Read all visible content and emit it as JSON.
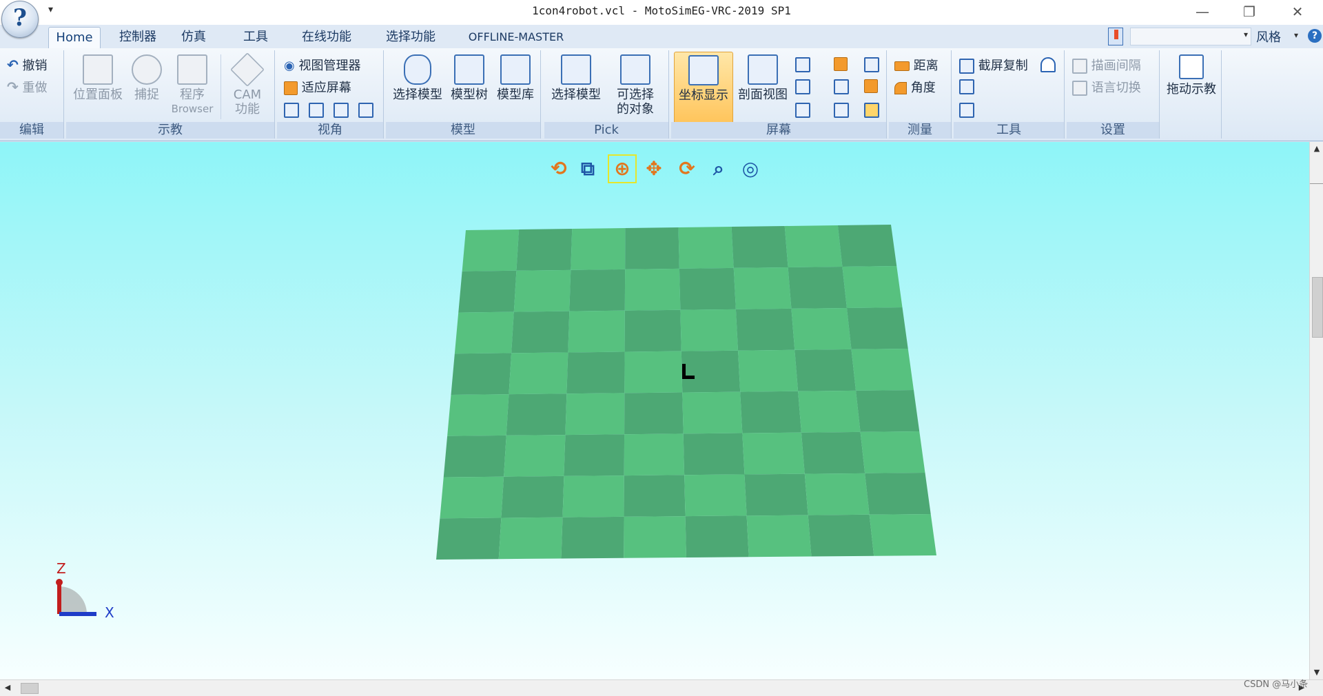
{
  "window": {
    "title": "1con4robot.vcl - MotoSimEG-VRC-2019 SP1",
    "app_logo": "?",
    "quick_access": "▾",
    "minimize": "—",
    "restore": "❐",
    "close": "✕"
  },
  "tabs": [
    {
      "label": "Home",
      "active": true
    },
    {
      "label": "控制器"
    },
    {
      "label": "仿真"
    },
    {
      "label": "工具"
    },
    {
      "label": "在线功能"
    },
    {
      "label": "选择功能"
    },
    {
      "label": "OFFLINE-MASTER"
    }
  ],
  "topright": {
    "style_label": "风格",
    "dropdown_arrow": "▾",
    "help": "?"
  },
  "ribbon": {
    "edit": {
      "label": "编辑",
      "undo": "撤销",
      "redo": "重做"
    },
    "teach": {
      "label": "示教",
      "position_panel": "位置面板",
      "capture": "捕捉",
      "program_line1": "程序",
      "program_line2": "Browser",
      "cam_line1": "CAM",
      "cam_line2": "功能"
    },
    "view": {
      "label": "视角",
      "view_manager": "视图管理器",
      "fit_screen": "适应屏幕"
    },
    "model": {
      "label": "模型",
      "select_model": "选择模型",
      "model_tree": "模型树",
      "model_library": "模型库"
    },
    "pick": {
      "label": "Pick",
      "select_model": "选择模型",
      "selectable_line1": "可选择",
      "selectable_line2": "的对象"
    },
    "screen": {
      "label": "屏幕",
      "coord_display": "坐标显示",
      "section_view": "剖面视图"
    },
    "measure": {
      "label": "测量",
      "distance": "距离",
      "angle": "角度"
    },
    "tools": {
      "label": "工具",
      "screenshot_copy": "截屏复制"
    },
    "settings": {
      "label": "设置",
      "draw_interval": "描画间隔",
      "language_switch": "语言切换"
    },
    "drag_teach": {
      "label": "拖动示教"
    }
  },
  "viewport": {
    "background_top": "#8ef5f8",
    "background_bottom": "#f7ffff",
    "floor_light": "#57c17f",
    "floor_dark": "#4da874",
    "axis_z": "Z",
    "axis_x": "X",
    "toolbar_icons": [
      "rotate-icon",
      "zoom-box-icon",
      "orbit-icon",
      "pan-icon",
      "rotate-z-icon",
      "zoom-icon",
      "target-icon"
    ]
  },
  "watermark": "CSDN @马小条"
}
